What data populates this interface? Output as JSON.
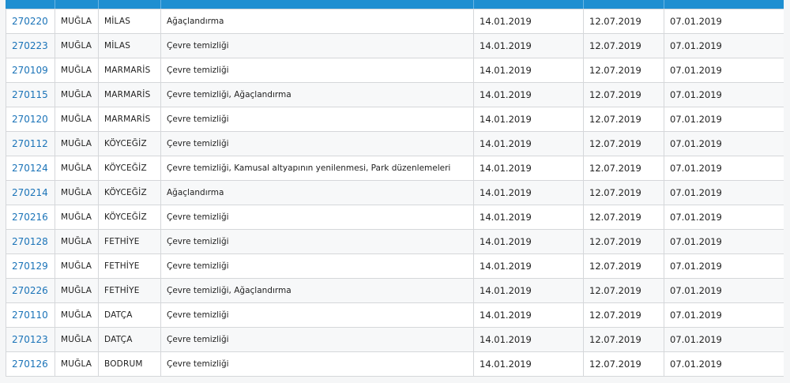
{
  "table": {
    "rows": [
      {
        "id": "270220",
        "province": "MUĞLA",
        "district": "MİLAS",
        "work": "Ağaçlandırma",
        "date1": "14.01.2019",
        "date2": "12.07.2019",
        "date3": "07.01.2019"
      },
      {
        "id": "270223",
        "province": "MUĞLA",
        "district": "MİLAS",
        "work": "Çevre temizliği",
        "date1": "14.01.2019",
        "date2": "12.07.2019",
        "date3": "07.01.2019"
      },
      {
        "id": "270109",
        "province": "MUĞLA",
        "district": "MARMARİS",
        "work": "Çevre temizliği",
        "date1": "14.01.2019",
        "date2": "12.07.2019",
        "date3": "07.01.2019"
      },
      {
        "id": "270115",
        "province": "MUĞLA",
        "district": "MARMARİS",
        "work": "Çevre temizliği, Ağaçlandırma",
        "date1": "14.01.2019",
        "date2": "12.07.2019",
        "date3": "07.01.2019"
      },
      {
        "id": "270120",
        "province": "MUĞLA",
        "district": "MARMARİS",
        "work": "Çevre temizliği",
        "date1": "14.01.2019",
        "date2": "12.07.2019",
        "date3": "07.01.2019"
      },
      {
        "id": "270112",
        "province": "MUĞLA",
        "district": "KÖYCEĞİZ",
        "work": "Çevre temizliği",
        "date1": "14.01.2019",
        "date2": "12.07.2019",
        "date3": "07.01.2019"
      },
      {
        "id": "270124",
        "province": "MUĞLA",
        "district": "KÖYCEĞİZ",
        "work": "Çevre temizliği, Kamusal altyapının yenilenmesi, Park düzenlemeleri",
        "date1": "14.01.2019",
        "date2": "12.07.2019",
        "date3": "07.01.2019"
      },
      {
        "id": "270214",
        "province": "MUĞLA",
        "district": "KÖYCEĞİZ",
        "work": "Ağaçlandırma",
        "date1": "14.01.2019",
        "date2": "12.07.2019",
        "date3": "07.01.2019"
      },
      {
        "id": "270216",
        "province": "MUĞLA",
        "district": "KÖYCEĞİZ",
        "work": "Çevre temizliği",
        "date1": "14.01.2019",
        "date2": "12.07.2019",
        "date3": "07.01.2019"
      },
      {
        "id": "270128",
        "province": "MUĞLA",
        "district": "FETHİYE",
        "work": "Çevre temizliği",
        "date1": "14.01.2019",
        "date2": "12.07.2019",
        "date3": "07.01.2019"
      },
      {
        "id": "270129",
        "province": "MUĞLA",
        "district": "FETHİYE",
        "work": "Çevre temizliği",
        "date1": "14.01.2019",
        "date2": "12.07.2019",
        "date3": "07.01.2019"
      },
      {
        "id": "270226",
        "province": "MUĞLA",
        "district": "FETHİYE",
        "work": "Çevre temizliği, Ağaçlandırma",
        "date1": "14.01.2019",
        "date2": "12.07.2019",
        "date3": "07.01.2019"
      },
      {
        "id": "270110",
        "province": "MUĞLA",
        "district": "DATÇA",
        "work": "Çevre temizliği",
        "date1": "14.01.2019",
        "date2": "12.07.2019",
        "date3": "07.01.2019"
      },
      {
        "id": "270123",
        "province": "MUĞLA",
        "district": "DATÇA",
        "work": "Çevre temizliği",
        "date1": "14.01.2019",
        "date2": "12.07.2019",
        "date3": "07.01.2019"
      },
      {
        "id": "270126",
        "province": "MUĞLA",
        "district": "BODRUM",
        "work": "Çevre temizliği",
        "date1": "14.01.2019",
        "date2": "12.07.2019",
        "date3": "07.01.2019"
      }
    ]
  },
  "colors": {
    "header": "#1f8fd1",
    "link": "#1a73b8",
    "border": "#d5d7da"
  }
}
